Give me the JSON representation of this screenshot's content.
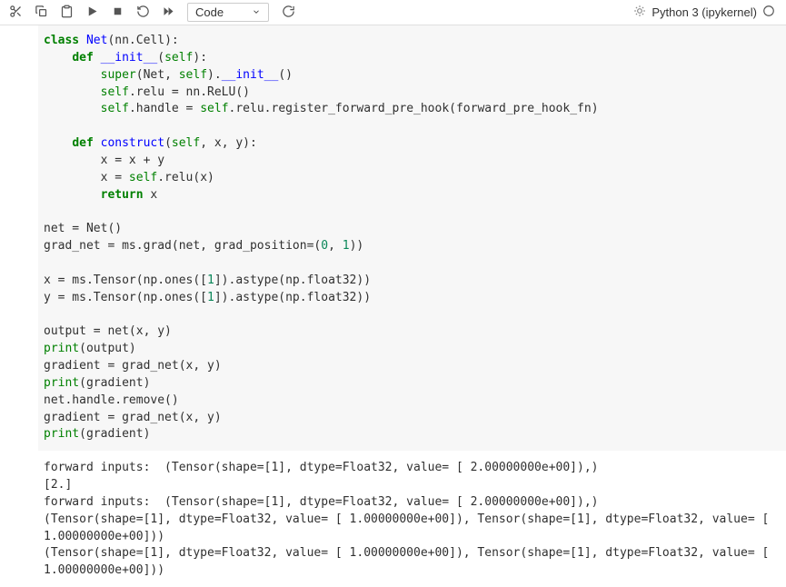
{
  "toolbar": {
    "cell_type": "Code",
    "kernel_name": "Python 3 (ipykernel)",
    "icons": {
      "save": "save-icon",
      "cut": "cut-icon",
      "copy": "copy-icon",
      "paste": "paste-icon",
      "run": "run-icon",
      "stop": "stop-icon",
      "restart": "restart-icon",
      "fastforward": "fastforward-icon",
      "refresh_kernel": "refresh-kernel-icon",
      "kernel_busy": "kernel-busy-icon",
      "kernel_status_circle": "kernel-status-circle-icon"
    }
  },
  "code": {
    "line1_kw": "class",
    "line1_cls": " Net",
    "line1_rest": "(nn.Cell):",
    "line2_indent": "    ",
    "line2_kw": "def",
    "line2_fn": " __init__",
    "line2_rest": "(",
    "line2_self": "self",
    "line2_close": "):",
    "line3_indent": "        ",
    "line3_builtin": "super",
    "line3_rest1": "(Net, ",
    "line3_self": "self",
    "line3_rest2": ").",
    "line3_fn": "__init__",
    "line3_rest3": "()",
    "line4_indent": "        ",
    "line4_self": "self",
    "line4_rest": ".relu = nn.ReLU()",
    "line5_indent": "        ",
    "line5_self": "self",
    "line5_rest1": ".handle = ",
    "line5_self2": "self",
    "line5_rest2": ".relu.register_forward_pre_hook(forward_pre_hook_fn)",
    "line7_indent": "    ",
    "line7_kw": "def",
    "line7_fn": " construct",
    "line7_rest1": "(",
    "line7_self": "self",
    "line7_rest2": ", x, y):",
    "line8": "        x = x + y",
    "line9_indent": "        x = ",
    "line9_self": "self",
    "line9_rest": ".relu(x)",
    "line10_indent": "        ",
    "line10_kw": "return",
    "line10_rest": " x",
    "line12": "net = Net()",
    "line13_a": "grad_net = ms.grad(net, grad_position=(",
    "line13_n1": "0",
    "line13_mid": ", ",
    "line13_n2": "1",
    "line13_b": "))",
    "line15_a": "x = ms.Tensor(np.ones([",
    "line15_n": "1",
    "line15_b": "]).astype(np.float32))",
    "line16_a": "y = ms.Tensor(np.ones([",
    "line16_n": "1",
    "line16_b": "]).astype(np.float32))",
    "line18": "output = net(x, y)",
    "line19_p": "print",
    "line19_r": "(output)",
    "line20": "gradient = grad_net(x, y)",
    "line21_p": "print",
    "line21_r": "(gradient)",
    "line22": "net.handle.remove()",
    "line23": "gradient = grad_net(x, y)",
    "line24_p": "print",
    "line24_r": "(gradient)"
  },
  "output_text": "forward inputs:  (Tensor(shape=[1], dtype=Float32, value= [ 2.00000000e+00]),)\n[2.]\nforward inputs:  (Tensor(shape=[1], dtype=Float32, value= [ 2.00000000e+00]),)\n(Tensor(shape=[1], dtype=Float32, value= [ 1.00000000e+00]), Tensor(shape=[1], dtype=Float32, value= [ 1.00000000e+00]))\n(Tensor(shape=[1], dtype=Float32, value= [ 1.00000000e+00]), Tensor(shape=[1], dtype=Float32, value= [ 1.00000000e+00]))"
}
